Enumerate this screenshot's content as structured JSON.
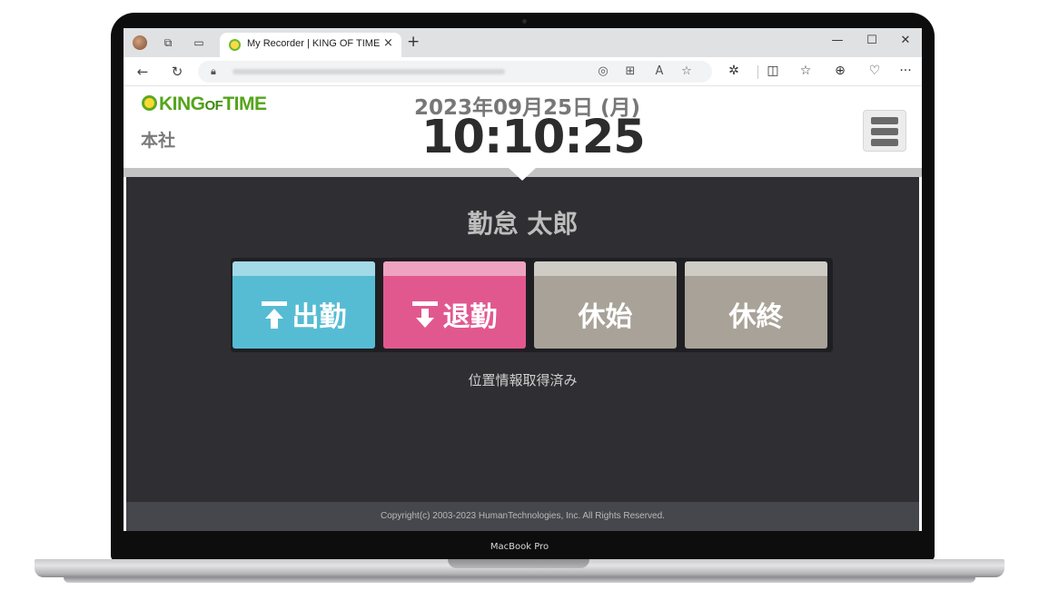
{
  "device": {
    "model_label": "MacBook Pro"
  },
  "browser": {
    "tab_title": "My Recorder | KING OF TIME",
    "tab_close": "×",
    "new_tab": "+",
    "window_controls": {
      "minimize": "—",
      "maximize": "☐",
      "close": "✕"
    },
    "icons": [
      "profile-icon",
      "workspaces-icon",
      "tab-actions-icon",
      "back-icon",
      "refresh-icon",
      "site-info-icon",
      "location-icon",
      "app-available-icon",
      "read-aloud-icon",
      "favorite-star-icon",
      "extensions-icon",
      "split-screen-icon",
      "favorites-icon",
      "collections-icon",
      "browser-essentials-icon",
      "more-icon"
    ]
  },
  "header": {
    "logo": "KING OF TIME",
    "office": "本社",
    "date": "2023年09月25日 (月)",
    "time": "10:10:25"
  },
  "main": {
    "employee_name": "勤怠 太郎",
    "buttons": [
      {
        "label": "出勤",
        "color": "#56bcd3",
        "icon": "clock-in-arrow-up-icon"
      },
      {
        "label": "退勤",
        "color": "#e1588f",
        "icon": "clock-out-arrow-down-icon"
      },
      {
        "label": "休始",
        "color": "#a8a298"
      },
      {
        "label": "休終",
        "color": "#a8a298"
      }
    ],
    "status_text": "位置情報取得済み"
  },
  "footer": {
    "copyright": "Copyright(c) 2003-2023 HumanTechnologies, Inc. All Rights Reserved."
  },
  "colors": {
    "background_dark": "#2f2f33",
    "footer": "#45474c",
    "logo_green": "#54a51c"
  }
}
